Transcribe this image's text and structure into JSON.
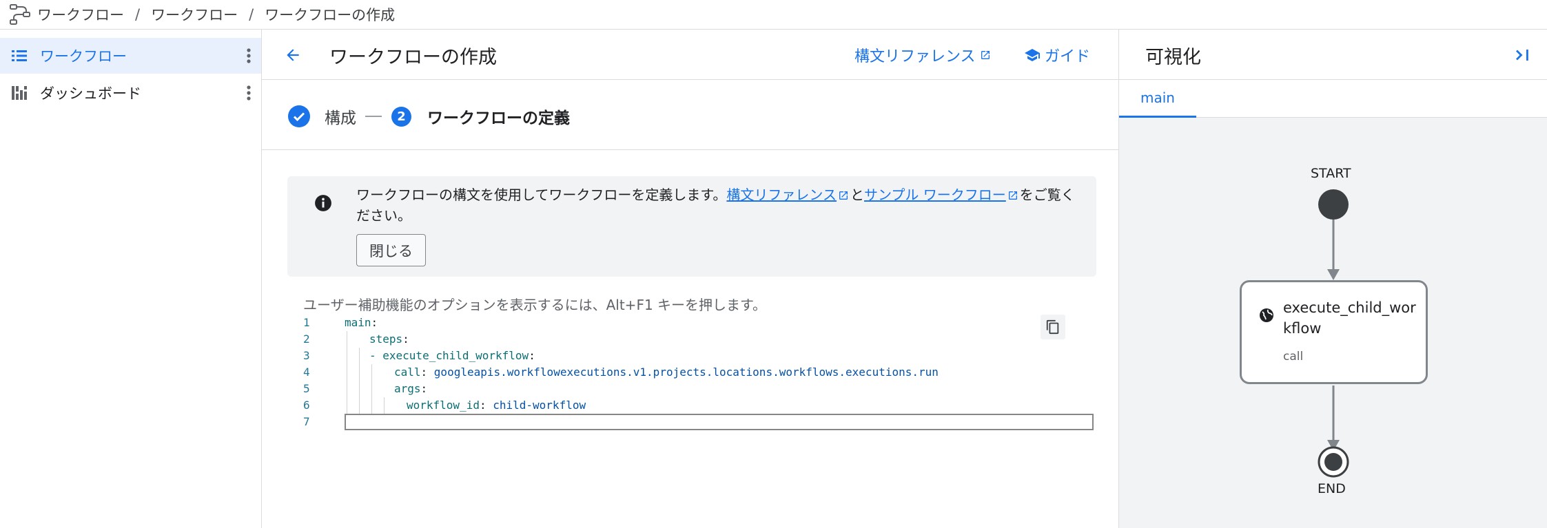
{
  "breadcrumb": [
    "ワークフロー",
    "ワークフロー",
    "ワークフローの作成"
  ],
  "sidebar": {
    "items": [
      {
        "label": "ワークフロー",
        "icon": "list-icon",
        "active": true
      },
      {
        "label": "ダッシュボード",
        "icon": "dashboard-icon",
        "active": false
      }
    ]
  },
  "header": {
    "title": "ワークフローの作成",
    "syntax_ref_label": "構文リファレンス",
    "guide_label": "ガイド"
  },
  "stepper": {
    "step1_label": "構成",
    "step2_number": "2",
    "step2_label": "ワークフローの定義"
  },
  "info": {
    "text_prefix": "ワークフローの構文を使用してワークフローを定義します。",
    "link1": "構文リファレンス",
    "joiner": "と",
    "link2": "サンプル ワークフロー",
    "text_suffix": "をご覧ください。",
    "close_label": "閉じる"
  },
  "editor": {
    "hint": "ユーザー補助機能のオプションを表示するには、Alt+F1 キーを押します。",
    "lines": [
      {
        "n": "1",
        "key": "main",
        "value": ""
      },
      {
        "n": "2",
        "key": "steps",
        "value": ""
      },
      {
        "n": "3",
        "key": "- execute_child_workflow",
        "value": ""
      },
      {
        "n": "4",
        "key": "call",
        "value": "googleapis.workflowexecutions.v1.projects.locations.workflows.executions.run"
      },
      {
        "n": "5",
        "key": "args",
        "value": ""
      },
      {
        "n": "6",
        "key": "workflow_id",
        "value": "child-workflow"
      },
      {
        "n": "7",
        "key": "",
        "value": ""
      }
    ]
  },
  "visualization": {
    "title": "可視化",
    "tab": "main",
    "start_label": "START",
    "end_label": "END",
    "node_name": "execute_child_workflow",
    "node_type": "call"
  },
  "colors": {
    "accent": "#1a73e8",
    "panel_bg": "#f1f3f4"
  }
}
